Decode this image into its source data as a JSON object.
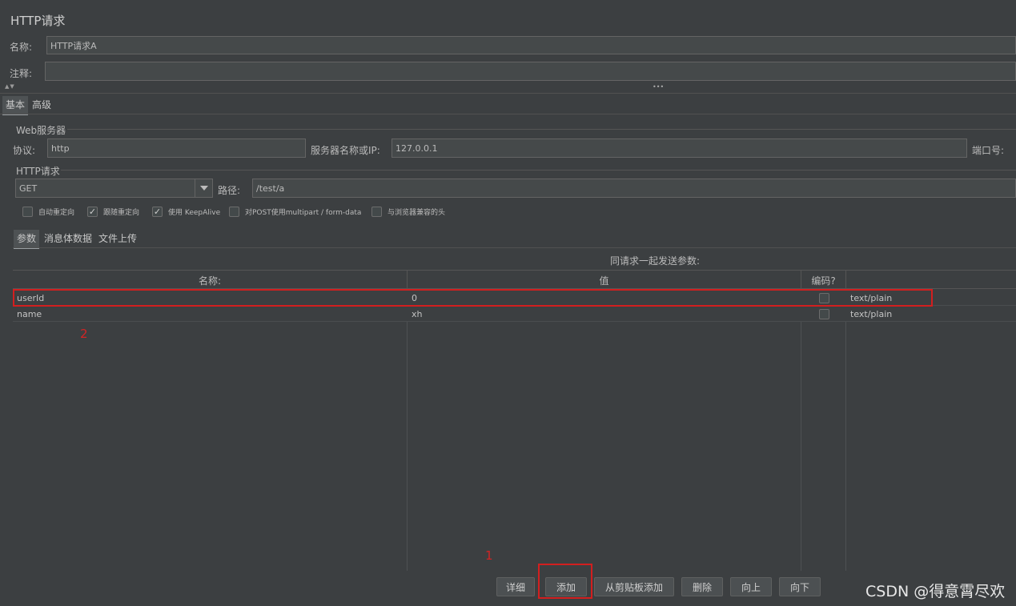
{
  "title": "HTTP请求",
  "name_label": "名称:",
  "name_value": "HTTP请求A",
  "comment_label": "注释:",
  "comment_value": "",
  "collapse_arrows": "▲▼",
  "splitter_dots": "•••",
  "top_tabs": [
    "基本",
    "高级"
  ],
  "web_server": {
    "group_label": "Web服务器",
    "protocol_label": "协议:",
    "protocol_value": "http",
    "server_label": "服务器名称或IP:",
    "server_value": "127.0.0.1",
    "port_label": "端口号:"
  },
  "http_request": {
    "group_label": "HTTP请求",
    "method": "GET",
    "path_label": "路径:",
    "path_value": "/test/a"
  },
  "options": [
    {
      "label": "自动重定向",
      "checked": false
    },
    {
      "label": "跟随重定向",
      "checked": true
    },
    {
      "label": "使用 KeepAlive",
      "checked": true
    },
    {
      "label": "对POST使用multipart / form-data",
      "checked": false
    },
    {
      "label": "与浏览器兼容的头",
      "checked": false
    }
  ],
  "sub_tabs": [
    "参数",
    "消息体数据",
    "文件上传"
  ],
  "table_caption": "同请求一起发送参数:",
  "columns": [
    "名称:",
    "值",
    "编码?",
    ""
  ],
  "rows": [
    {
      "name": "userId",
      "value": "0",
      "encode": false,
      "content_type": "text/plain"
    },
    {
      "name": "name",
      "value": "xh",
      "encode": false,
      "content_type": "text/plain"
    }
  ],
  "buttons": [
    "详细",
    "添加",
    "从剪贴板添加",
    "删除",
    "向上",
    "向下"
  ],
  "annotations": {
    "one": "1",
    "two": "2"
  },
  "watermark": "CSDN @得意霄尽欢",
  "colors": {
    "accent_red": "#d21f1f",
    "background": "#3c3f41",
    "field": "#45494a"
  }
}
